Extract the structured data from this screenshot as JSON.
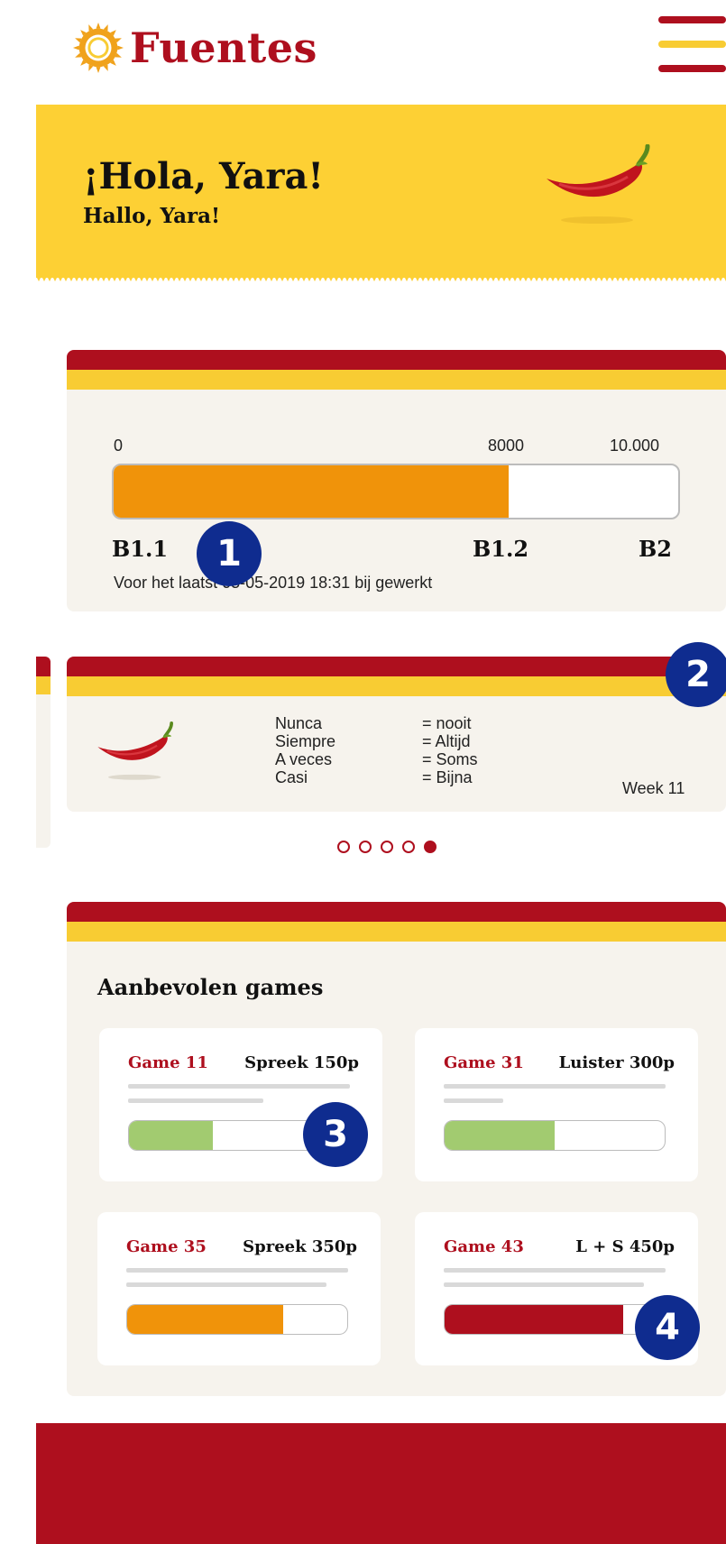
{
  "header": {
    "brand": "Fuentes",
    "menu_icon": "hamburger-menu-icon",
    "colors": {
      "red": "#ae0f1e",
      "yellow": "#f8cc33"
    }
  },
  "greeting": {
    "spanish": "¡Hola, Yara!",
    "dutch": "Hallo, Yara!"
  },
  "progress": {
    "min_label": "0",
    "mid_label": "8000",
    "max_label": "10.000",
    "current_fraction": 0.7,
    "level_current": "B1.1",
    "level_next": "B1.2",
    "level_final": "B2",
    "updated_text": "Voor het laatst 05-05-2019 18:31 bij gewerkt"
  },
  "badges": [
    "1",
    "2",
    "3",
    "4"
  ],
  "vocab": {
    "spanish": [
      "Nunca",
      "Siempre",
      "A veces",
      "Casi"
    ],
    "dutch": [
      "= nooit",
      "= Altijd",
      "= Soms",
      "= Bijna"
    ],
    "week": "Week 11",
    "carousel_count": 5,
    "carousel_active": 5
  },
  "games": {
    "title": "Aanbevolen games",
    "items": [
      {
        "name": "Game 11",
        "points": "Spreek 150p",
        "progress": 0.38,
        "color": "#a2cb70"
      },
      {
        "name": "Game 31",
        "points": "Luister 300p",
        "progress": 0.5,
        "color": "#a2cb70"
      },
      {
        "name": "Game 35",
        "points": "Spreek 350p",
        "progress": 0.71,
        "color": "#f0930a"
      },
      {
        "name": "Game 43",
        "points": "L + S 450p",
        "progress": 0.81,
        "color": "#ae0f1e"
      }
    ]
  }
}
